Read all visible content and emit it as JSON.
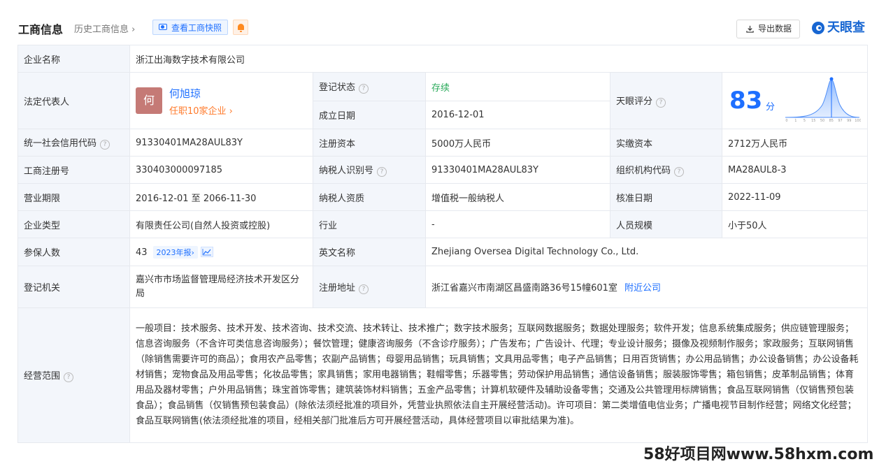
{
  "header": {
    "title": "工商信息",
    "history_link": "历史工商信息 ›",
    "snapshot_button": "查看工商快照",
    "export_button": "导出数据",
    "logo_text": "天眼查"
  },
  "company_name": {
    "label": "企业名称",
    "value": "浙江出海数字技术有限公司"
  },
  "legal_rep": {
    "label": "法定代表人",
    "avatar_char": "何",
    "name": "何旭琼",
    "sub": "任职10家企业 ›"
  },
  "reg_status": {
    "label": "登记状态",
    "value": "存续"
  },
  "founded": {
    "label": "成立日期",
    "value": "2016-12-01"
  },
  "score": {
    "label": "天眼评分",
    "value": "83",
    "unit": "分",
    "axis_ticks": [
      "0",
      "1",
      "5",
      "15",
      "50",
      "85",
      "97",
      "99",
      "100"
    ],
    "color": "#1e6fff"
  },
  "credit_code": {
    "label": "统一社会信用代码",
    "value": "91330401MA28AUL83Y"
  },
  "reg_capital": {
    "label": "注册资本",
    "value": "5000万人民币"
  },
  "paid_capital": {
    "label": "实缴资本",
    "value": "2712万人民币"
  },
  "reg_no": {
    "label": "工商注册号",
    "value": "330403000097185"
  },
  "taxpayer_id": {
    "label": "纳税人识别号",
    "value": "91330401MA28AUL83Y"
  },
  "org_code": {
    "label": "组织机构代码",
    "value": "MA28AUL8-3"
  },
  "term": {
    "label": "营业期限",
    "value": "2016-12-01 至 2066-11-30"
  },
  "taxpayer_type": {
    "label": "纳税人资质",
    "value": "增值税一般纳税人"
  },
  "approve_date": {
    "label": "核准日期",
    "value": "2022-11-09"
  },
  "company_type": {
    "label": "企业类型",
    "value": "有限责任公司(自然人投资或控股)"
  },
  "industry": {
    "label": "行业",
    "value": "-"
  },
  "staff_size": {
    "label": "人员规模",
    "value": "小于50人"
  },
  "insured": {
    "label": "参保人数",
    "value": "43",
    "report_tag": "2023年报›"
  },
  "english_name": {
    "label": "英文名称",
    "value": "Zhejiang Oversea Digital Technology Co., Ltd."
  },
  "authority": {
    "label": "登记机关",
    "value": "嘉兴市市场监督管理局经济技术开发区分局"
  },
  "address": {
    "label": "注册地址",
    "value": "浙江省嘉兴市南湖区昌盛南路36号15幢601室",
    "nearby": "附近公司"
  },
  "scope": {
    "label": "经营范围",
    "value": "一般项目：技术服务、技术开发、技术咨询、技术交流、技术转让、技术推广；数字技术服务；互联网数据服务；数据处理服务；软件开发；信息系统集成服务；供应链管理服务；信息咨询服务（不含许可类信息咨询服务）；餐饮管理；健康咨询服务（不含诊疗服务）；广告发布；广告设计、代理；专业设计服务；摄像及视频制作服务；家政服务；互联网销售（除销售需要许可的商品）；食用农产品零售；农副产品销售；母婴用品销售；玩具销售；文具用品零售；电子产品销售；日用百货销售；办公用品销售；办公设备销售；办公设备耗材销售；宠物食品及用品零售；化妆品零售；家具销售；家用电器销售；鞋帽零售；乐器零售；劳动保护用品销售；通信设备销售；服装服饰零售；箱包销售；皮革制品销售；体育用品及器材零售；户外用品销售；珠宝首饰零售；建筑装饰材料销售；五金产品零售；计算机软硬件及辅助设备零售；交通及公共管理用标牌销售；食品互联网销售（仅销售预包装食品）；食品销售（仅销售预包装食品）(除依法须经批准的项目外，凭营业执照依法自主开展经营活动)。许可项目：第二类增值电信业务；广播电视节目制作经营；网络文化经营；食品互联网销售(依法须经批准的项目，经相关部门批准后方可开展经营活动，具体经营项目以审批结果为准)。"
  },
  "watermark": "58好项目网www.58hxm.com"
}
